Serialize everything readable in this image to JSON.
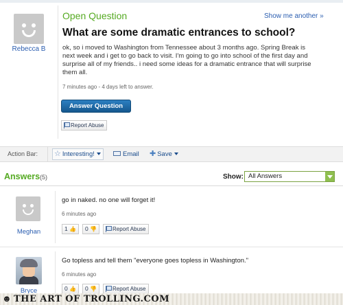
{
  "question": {
    "label": "Open Question",
    "show_another": "Show me another »",
    "asker": "Rebecca B",
    "title": "What are some dramatic entrances to school?",
    "body_lines": [
      "ok, so i moved to Washington from Tennessee about 3 months ago. Spring Break is",
      "next week and i get to go back to visit. I'm going to go into school of the first day and",
      "surprise all of my friends.. i need some ideas for a dramatic entrance that will surprise",
      "them all."
    ],
    "time_left": "7 minutes ago - 4 days left to answer.",
    "answer_button": "Answer Question",
    "report_abuse": "Report Abuse"
  },
  "action_bar": {
    "label": "Action Bar:",
    "interesting": "Interesting!",
    "email": "Email",
    "save": "Save"
  },
  "answers": {
    "title": "Answers",
    "count": "(5)",
    "show_label": "Show:",
    "show_value": "All Answers",
    "items": [
      {
        "user": "Meghan",
        "text": "go in naked. no one will forget it!",
        "time": "6 minutes ago",
        "up": "1",
        "down": "0",
        "report": "Report Abuse"
      },
      {
        "user": "Bryce",
        "text": "Go topless and tell them \"everyone goes topless in Washington.\"",
        "time": "6 minutes ago",
        "up": "0",
        "down": "0",
        "report": "Report Abuse"
      }
    ]
  },
  "watermark": {
    "text": "THE ART OF TROLLING.COM"
  },
  "icons": {
    "thumb_up": "thumb-up-icon",
    "thumb_down": "thumb-down-icon",
    "flag": "flag-icon",
    "star": "star-icon",
    "email": "email-icon",
    "save": "plus-icon"
  },
  "colors": {
    "accent_green": "#55aa22",
    "link_blue": "#2a5db0",
    "button_blue": "#1a6aab"
  }
}
